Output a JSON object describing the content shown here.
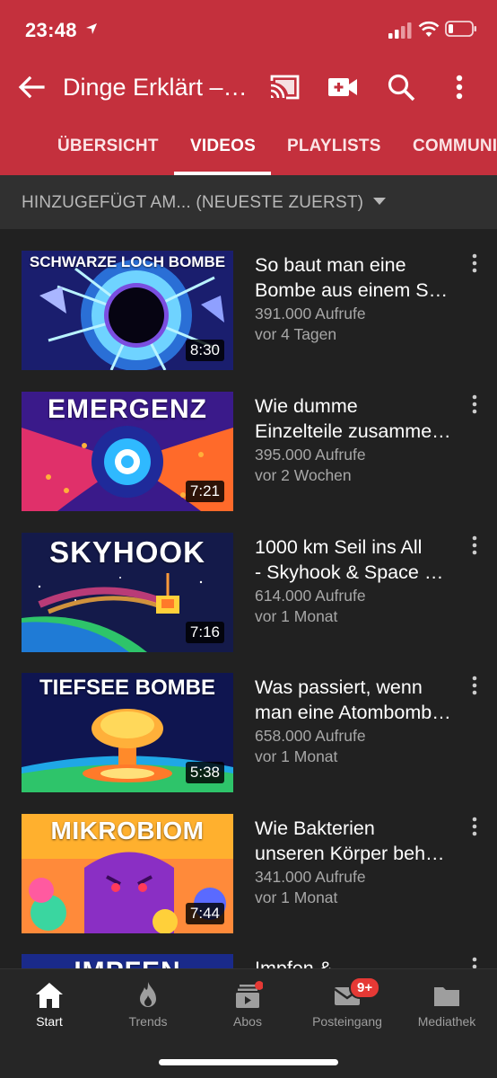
{
  "status_bar": {
    "time": "23:48"
  },
  "app_bar": {
    "channel_title": "Dinge Erklärt – Kurzgesagt"
  },
  "tabs": [
    {
      "label": "ÜBERSICHT",
      "active": false
    },
    {
      "label": "VIDEOS",
      "active": true
    },
    {
      "label": "PLAYLISTS",
      "active": false
    },
    {
      "label": "COMMUNITY",
      "active": false
    }
  ],
  "sort": {
    "label": "HINZUGEFÜGT AM... (NEUESTE ZUERST)"
  },
  "videos": [
    {
      "thumb_text": "SCHWARZE LOCH BOMBE",
      "duration": "8:30",
      "title_line1": "So baut man eine",
      "title_line2": "Bombe aus einem Schwarzen Loch",
      "views": "391.000 Aufrufe",
      "date": "vor 4 Tagen"
    },
    {
      "thumb_text": "EMERGENZ",
      "duration": "7:21",
      "title_line1": "Wie dumme",
      "title_line2": "Einzelteile zusammen etwas Großes schaffen",
      "views": "395.000 Aufrufe",
      "date": "vor 2 Wochen"
    },
    {
      "thumb_text": "SKYHOOK",
      "duration": "7:16",
      "title_line1": "1000 km Seil ins All",
      "title_line2": "- Skyhook & Space Elevator",
      "views": "614.000 Aufrufe",
      "date": "vor 1 Monat"
    },
    {
      "thumb_text": "TIEFSEE BOMBE",
      "duration": "5:38",
      "title_line1": "Was passiert, wenn",
      "title_line2": "man eine Atombombe in der Tiefsee zündet",
      "views": "658.000 Aufrufe",
      "date": "vor 1 Monat"
    },
    {
      "thumb_text": "MIKROBIOM",
      "duration": "7:44",
      "title_line1": "Wie Bakterien",
      "title_line2": "unseren Körper beherrschen",
      "views": "341.000 Aufrufe",
      "date": "vor 1 Monat"
    },
    {
      "thumb_text": "IMPFEN",
      "duration": "",
      "title_line1": "Impfen &",
      "title_line2": "",
      "views": "",
      "date": ""
    }
  ],
  "bottom_nav": [
    {
      "label": "Start",
      "icon": "home-icon",
      "active": true
    },
    {
      "label": "Trends",
      "icon": "flame-icon",
      "active": false
    },
    {
      "label": "Abos",
      "icon": "subscriptions-icon",
      "active": false
    },
    {
      "label": "Posteingang",
      "icon": "inbox-icon",
      "active": false
    },
    {
      "label": "Mediathek",
      "icon": "library-icon",
      "active": false
    }
  ],
  "inbox_badge": "9+",
  "colors": {
    "header_red": "#c4303d",
    "background": "#212121",
    "secondary_text": "#a7a7a7",
    "badge_red": "#e53935"
  }
}
